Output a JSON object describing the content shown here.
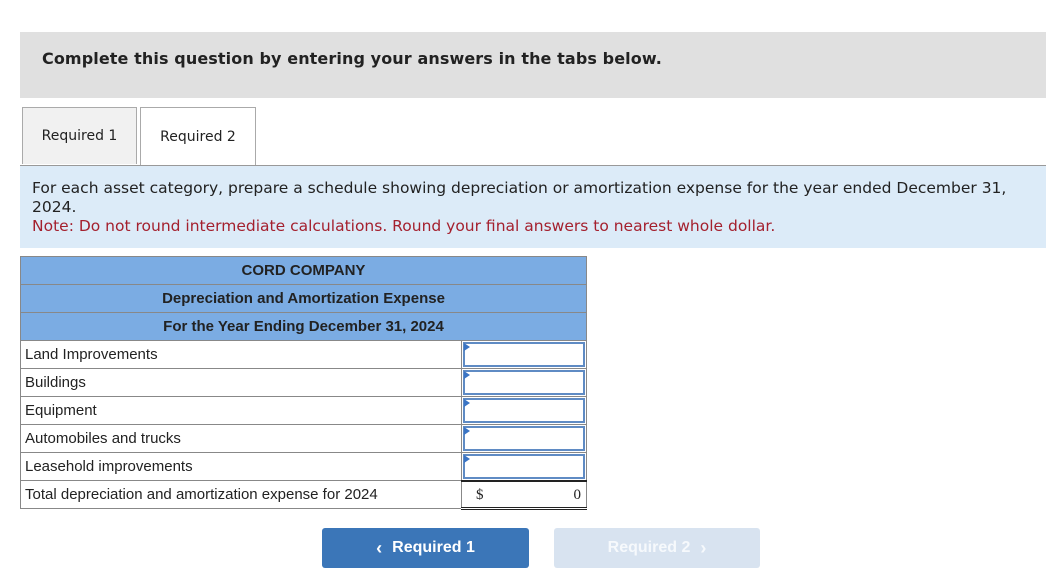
{
  "banner": {
    "text": "Complete this question by entering your answers in the tabs below."
  },
  "tabs": [
    {
      "label": "Required 1",
      "active": false
    },
    {
      "label": "Required 2",
      "active": true
    }
  ],
  "instructions": {
    "line1": "For each asset category, prepare a schedule showing depreciation or amortization expense for the year ended December 31,",
    "line2": "2024.",
    "note": "Note: Do not round intermediate calculations. Round your final answers to nearest whole dollar."
  },
  "schedule": {
    "company": "CORD COMPANY",
    "title": "Depreciation and Amortization Expense",
    "period": "For the Year Ending December 31, 2024",
    "rows": [
      {
        "label": "Land Improvements",
        "value": ""
      },
      {
        "label": "Buildings",
        "value": ""
      },
      {
        "label": "Equipment",
        "value": ""
      },
      {
        "label": "Automobiles and trucks",
        "value": ""
      },
      {
        "label": "Leasehold improvements",
        "value": ""
      }
    ],
    "total": {
      "label": "Total depreciation and amortization expense for 2024",
      "currency": "$",
      "value": "0"
    }
  },
  "nav": {
    "prev_label": "Required 1",
    "prev_icon": "chevron-left-icon",
    "next_label": "Required 2",
    "next_icon": "chevron-right-icon"
  },
  "colors": {
    "header_blue": "#7bace3",
    "prev_button": "#3b76b8",
    "next_button_disabled": "#d8e3f0",
    "note_red": "#a4202e",
    "instructions_bg": "#dcebf8"
  }
}
